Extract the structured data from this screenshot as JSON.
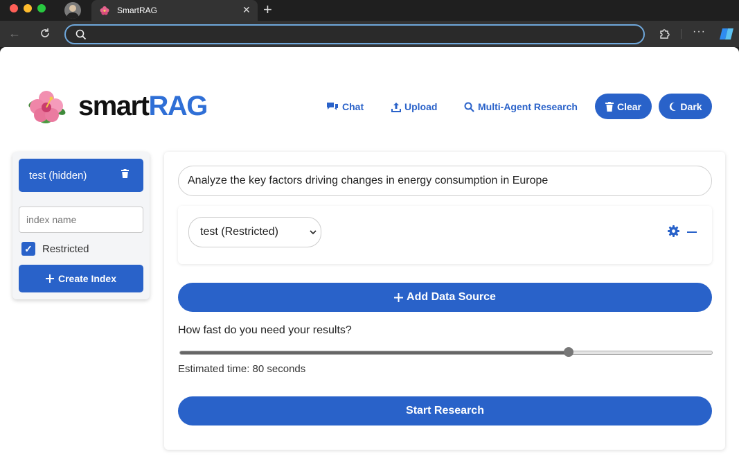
{
  "browser": {
    "tab_title": "SmartRAG",
    "tab_close": "✕",
    "new_tab": "+",
    "address_value": "",
    "more": "···"
  },
  "header": {
    "logo_smart": "smart",
    "logo_rag": "RAG",
    "nav": {
      "chat": "Chat",
      "upload": "Upload",
      "research": "Multi-Agent Research"
    },
    "clear_label": "Clear",
    "dark_label": "Dark"
  },
  "sidebar": {
    "indexes": [
      {
        "label": "test (hidden)"
      }
    ],
    "index_name_placeholder": "index name",
    "restricted_label": "Restricted",
    "restricted_checked": true,
    "create_index_label": "Create Index"
  },
  "main": {
    "query_value": "Analyze the key factors driving changes in energy consumption in Europe",
    "data_source_selected": "test (Restricted)",
    "add_source_label": "Add Data Source",
    "speed_question": "How fast do you need your results?",
    "speed_slider_fraction": 0.73,
    "estimated_time_text": "Estimated time: 80 seconds",
    "start_label": "Start Research"
  },
  "colors": {
    "accent": "#2962c9",
    "logo_rag": "#2f6fd6"
  }
}
